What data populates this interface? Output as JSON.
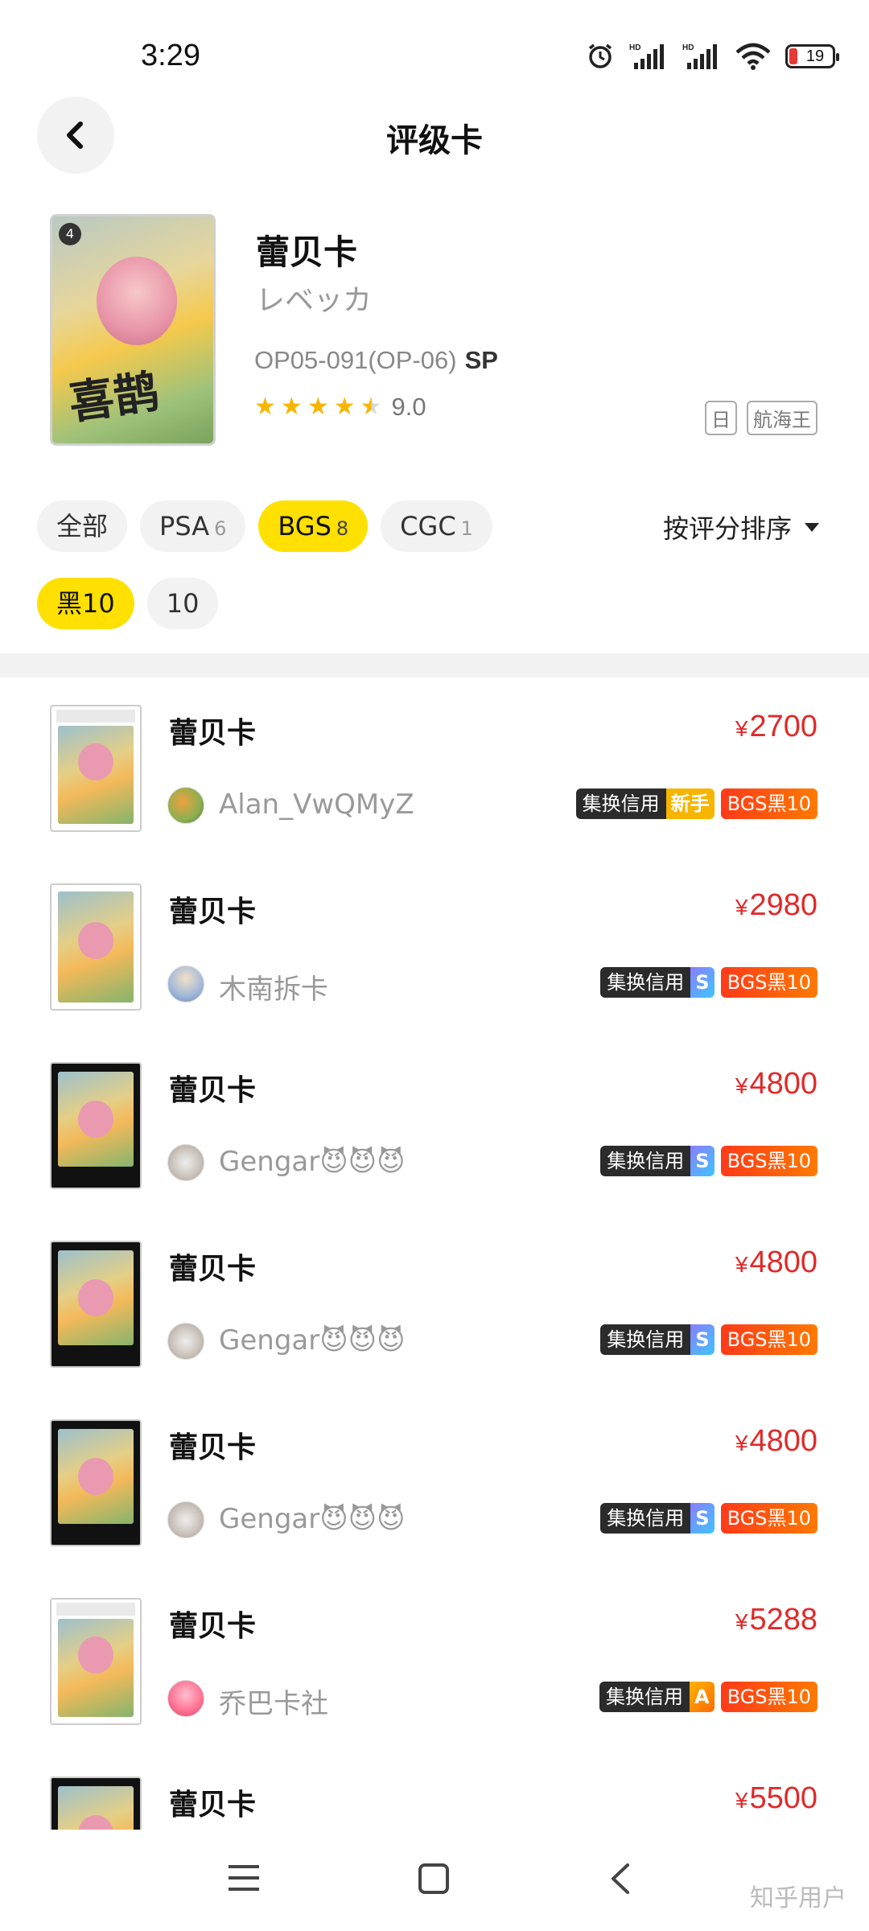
{
  "status_bar": {
    "time": "3:29",
    "battery": "19",
    "net1": "HD",
    "net2": "HD"
  },
  "header": {
    "title": "评级卡"
  },
  "product": {
    "name": "蕾贝卡",
    "jp_name": "レベッカ",
    "code": "OP05-091(OP-06)",
    "rarity": "SP",
    "rating": "9.0",
    "tags": [
      "日",
      "航海王"
    ],
    "card_badge": "4",
    "signature": "喜鹊"
  },
  "filters": {
    "row1": [
      {
        "label": "全部",
        "count": ""
      },
      {
        "label": "PSA",
        "count": "6"
      },
      {
        "label": "BGS",
        "count": "8"
      },
      {
        "label": "CGC",
        "count": "1"
      }
    ],
    "row2": [
      {
        "label": "黑10"
      },
      {
        "label": "10"
      }
    ],
    "sort_label": "按评分排序"
  },
  "listings": [
    {
      "title": "蕾贝卡",
      "price": "2700",
      "currency": "¥",
      "seller": "Alan_VwQMyZ",
      "credit": "集换信用",
      "level": "新手",
      "grade": "BGS黑10"
    },
    {
      "title": "蕾贝卡",
      "price": "2980",
      "currency": "¥",
      "seller": "木南拆卡",
      "credit": "集换信用",
      "level": "S",
      "grade": "BGS黑10"
    },
    {
      "title": "蕾贝卡",
      "price": "4800",
      "currency": "¥",
      "seller": "Gengar😈😈😈",
      "credit": "集换信用",
      "level": "S",
      "grade": "BGS黑10"
    },
    {
      "title": "蕾贝卡",
      "price": "4800",
      "currency": "¥",
      "seller": "Gengar😈😈😈",
      "credit": "集换信用",
      "level": "S",
      "grade": "BGS黑10"
    },
    {
      "title": "蕾贝卡",
      "price": "4800",
      "currency": "¥",
      "seller": "Gengar😈😈😈",
      "credit": "集换信用",
      "level": "S",
      "grade": "BGS黑10"
    },
    {
      "title": "蕾贝卡",
      "price": "5288",
      "currency": "¥",
      "seller": "乔巴卡社",
      "credit": "集换信用",
      "level": "A",
      "grade": "BGS黑10"
    },
    {
      "title": "蕾贝卡",
      "price": "5500",
      "currency": "¥",
      "seller": "",
      "credit": "",
      "level": "",
      "grade": ""
    }
  ],
  "watermark": "知乎用户",
  "colors": {
    "accent": "#ffe000",
    "price": "#e02a2a",
    "grade_badge": "#ff5a10"
  }
}
